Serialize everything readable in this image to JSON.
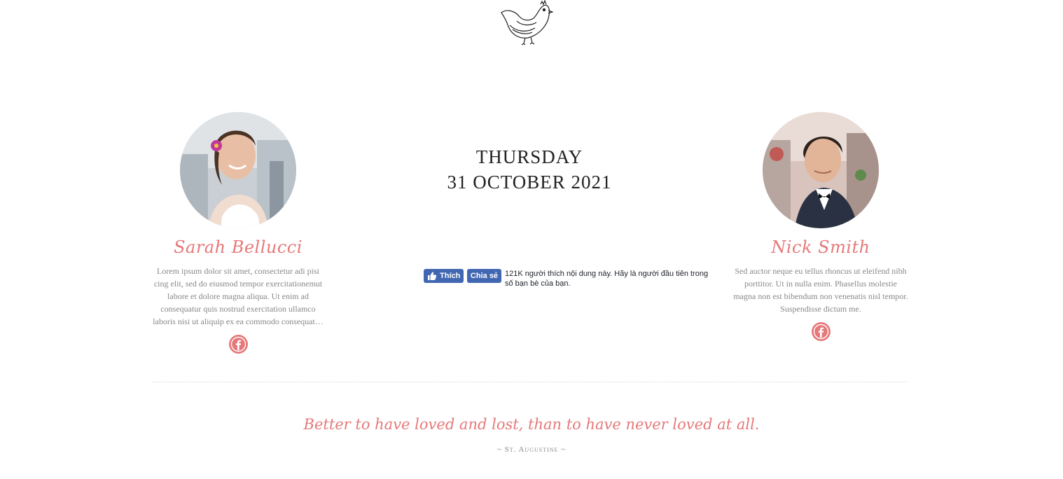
{
  "logo": {
    "icon": "bird-icon"
  },
  "bride": {
    "name": "Sarah Bellucci",
    "bio": "Lorem ipsum dolor sit amet, consectetur adi pisi cing elit, sed do eiusmod tempor exercitationemut labore et dolore magna aliqua. Ut enim ad consequatur quis nostrud exercitation ullamco laboris nisi ut aliquip ex ea commodo consequat…",
    "social_icon": "facebook-icon"
  },
  "groom": {
    "name": "Nick Smith",
    "bio": "Sed auctor neque eu tellus rhoncus ut eleifend nibh porttitor. Ut in nulla enim. Phasellus molestie magna non est bibendum non venenatis nisl tempor. Suspendisse dictum me.",
    "social_icon": "facebook-icon"
  },
  "event_date": {
    "weekday": "THURSDAY",
    "date": "31 OCTOBER 2021"
  },
  "facebook_widget": {
    "like_label": "Thích",
    "share_label": "Chia sẻ",
    "social_text": "121K người thích nội dung này. Hãy là người đầu tiên trong số bạn bè của bạn."
  },
  "quote": {
    "text": "Better to have loved and lost, than to have never loved at all.",
    "author": "~ St. Augustine ~"
  },
  "colors": {
    "accent": "#e6787a",
    "facebook_blue": "#4267b2",
    "body_text": "#888888",
    "heading_text": "#222222"
  }
}
